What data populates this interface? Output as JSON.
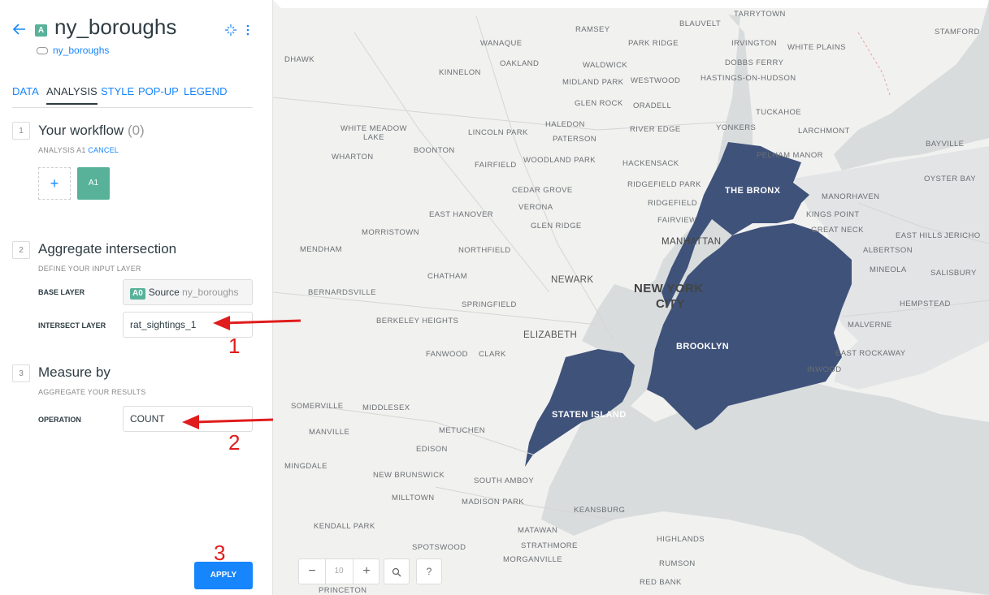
{
  "header": {
    "layer_badge": "A",
    "title": "ny_boroughs",
    "source_link": "ny_boroughs"
  },
  "tabs": [
    "DATA",
    "ANALYSIS",
    "STYLE",
    "POP-UP",
    "LEGEND"
  ],
  "workflow": {
    "step": "1",
    "title": "Your workflow",
    "count": "(0)",
    "subtitle": "ANALYSIS A1",
    "cancel": "CANCEL",
    "add": "+",
    "node": "A1"
  },
  "aggregate": {
    "step": "2",
    "title": "Aggregate intersection",
    "subtitle": "DEFINE YOUR INPUT LAYER",
    "base_label": "BASE LAYER",
    "base_badge": "A0",
    "base_value": "Source",
    "base_name": "ny_boroughs",
    "intersect_label": "INTERSECT LAYER",
    "intersect_value": "rat_sightings_1"
  },
  "measure": {
    "step": "3",
    "title": "Measure by",
    "subtitle": "AGGREGATE YOUR RESULTS",
    "operation_label": "OPERATION",
    "operation_value": "COUNT"
  },
  "apply_label": "APPLY",
  "annotations": [
    "1",
    "2",
    "3"
  ],
  "map": {
    "zoom_level": "10",
    "zoom_out": "−",
    "zoom_in": "+",
    "help": "?",
    "boroughs": [
      "THE BRONX",
      "MANHATTAN",
      "BROOKLYN",
      "STATEN ISLAND"
    ],
    "big_labels": [
      "NEW YORK",
      "CITY",
      "NEWARK",
      "ELIZABETH"
    ],
    "labels": [
      "TARRYTOWN",
      "RAMSEY",
      "BLAUVELT",
      "STAMFORD",
      "WANAQUE",
      "PARK RIDGE",
      "IRVINGTON",
      "WHITE PLAINS",
      "DHAWK",
      "OAKLAND",
      "WALDWICK",
      "DOBBS FERRY",
      "KINNELON",
      "MIDLAND PARK",
      "WESTWOOD",
      "HASTINGS-ON-HUDSON",
      "GLEN ROCK",
      "ORADELL",
      "TUCKAHOE",
      "HALEDON",
      "WHITE MEADOW",
      "LAKE",
      "LINCOLN PARK",
      "RIVER EDGE",
      "YONKERS",
      "LARCHMONT",
      "PATERSON",
      "BAYVILLE",
      "BOONTON",
      "WHARTON",
      "FAIRFIELD",
      "WOODLAND PARK",
      "HACKENSACK",
      "PELHAM MANOR",
      "OYSTER BAY",
      "CEDAR GROVE",
      "RIDGEFIELD PARK",
      "VERONA",
      "RIDGEFIELD",
      "MANORHAVEN",
      "EAST HANOVER",
      "GLEN RIDGE",
      "KINGS POINT",
      "FAIRVIEW",
      "MORRISTOWN",
      "GREAT NECK",
      "EAST HILLS",
      "JERICHO",
      "MENDHAM",
      "NORTHFIELD",
      "ALBERTSON",
      "MINEOLA",
      "SALISBURY",
      "CHATHAM",
      "BERNARDSVILLE",
      "SPRINGFIELD",
      "HEMPSTEAD",
      "BERKELEY HEIGHTS",
      "MALVERNE",
      "FANWOOD",
      "CLARK",
      "EAST ROCKAWAY",
      "INWOOD",
      "SOMERVILLE",
      "MIDDLESEX",
      "MANVILLE",
      "METUCHEN",
      "EDISON",
      "MINGDALE",
      "NEW BRUNSWICK",
      "SOUTH AMBOY",
      "MILLTOWN",
      "MADISON PARK",
      "KEANSBURG",
      "KENDALL PARK",
      "MATAWAN",
      "HIGHLANDS",
      "SPOTSWOOD",
      "STRATHMORE",
      "MORGANVILLE",
      "RUMSON",
      "RED BANK",
      "PRINCETON"
    ]
  }
}
